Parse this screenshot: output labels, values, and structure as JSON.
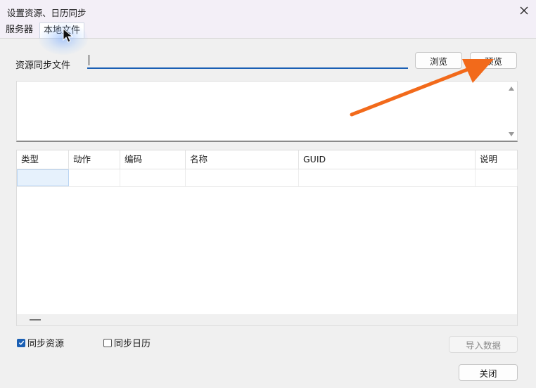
{
  "window": {
    "title": "设置资源、日历同步"
  },
  "tabs": [
    {
      "label": "服务器"
    },
    {
      "label": "本地文件",
      "active": true
    }
  ],
  "form": {
    "file_label": "资源同步文件",
    "file_value": "",
    "browse_label": "浏览",
    "preview_label": "预览"
  },
  "grid": {
    "columns": [
      "类型",
      "动作",
      "编码",
      "名称",
      "GUID",
      "说明"
    ],
    "rows": []
  },
  "options": {
    "sync_resources": {
      "label": "同步资源",
      "checked": true
    },
    "sync_calendar": {
      "label": "同步日历",
      "checked": false
    }
  },
  "actions": {
    "import_label": "导入数据",
    "close_label": "关闭"
  },
  "colors": {
    "accent": "#1a5fb4",
    "annotation_arrow": "#f26a1b"
  },
  "icons": [
    "close-icon",
    "mouse-pointer-icon",
    "checkmark-icon",
    "scroll-up-icon",
    "scroll-down-icon"
  ]
}
